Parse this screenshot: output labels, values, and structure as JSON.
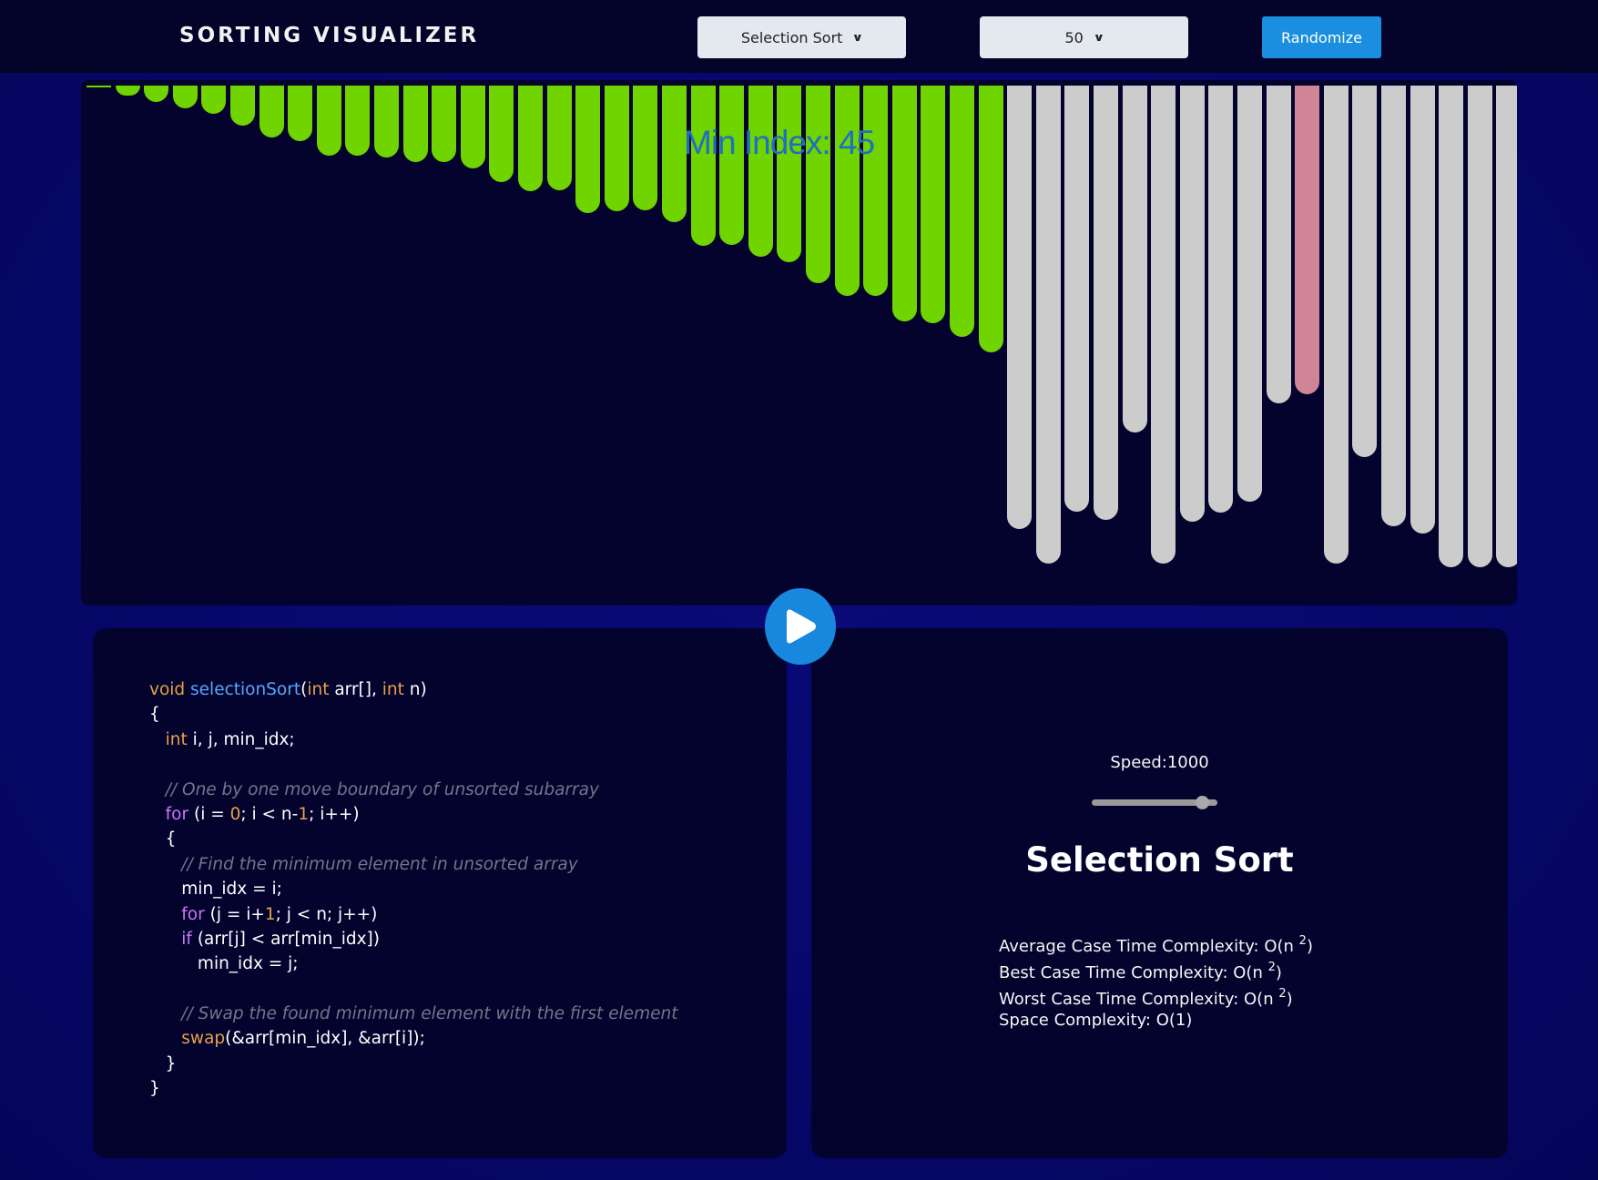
{
  "header": {
    "title": "SORTING VISUALIZER",
    "algorithm_select": {
      "selected": "Selection Sort"
    },
    "size_select": {
      "selected": "50"
    },
    "randomize_label": "Randomize"
  },
  "visualizer": {
    "min_index_label": "Min Index: 45",
    "bar_heights_relative": [
      0.004,
      0.019,
      0.032,
      0.045,
      0.056,
      0.078,
      0.101,
      0.109,
      0.137,
      0.137,
      0.141,
      0.15,
      0.15,
      0.163,
      0.19,
      0.207,
      0.205,
      0.25,
      0.246,
      0.244,
      0.268,
      0.315,
      0.312,
      0.336,
      0.347,
      0.388,
      0.412,
      0.413,
      0.463,
      0.466,
      0.493,
      0.524,
      0.87,
      0.937,
      0.835,
      0.852,
      0.68,
      0.937,
      0.855,
      0.838,
      0.816,
      0.624,
      0.606,
      0.937,
      0.728,
      0.865,
      0.878,
      0.945,
      0.945,
      0.945
    ],
    "states": [
      "sorted",
      "sorted",
      "sorted",
      "sorted",
      "sorted",
      "sorted",
      "sorted",
      "sorted",
      "sorted",
      "sorted",
      "sorted",
      "sorted",
      "sorted",
      "sorted",
      "sorted",
      "sorted",
      "sorted",
      "sorted",
      "sorted",
      "sorted",
      "sorted",
      "sorted",
      "sorted",
      "sorted",
      "sorted",
      "sorted",
      "sorted",
      "sorted",
      "sorted",
      "sorted",
      "sorted",
      "sorted",
      "unsorted",
      "unsorted",
      "unsorted",
      "unsorted",
      "unsorted",
      "unsorted",
      "unsorted",
      "unsorted",
      "unsorted",
      "unsorted",
      "current",
      "unsorted",
      "unsorted",
      "unsorted",
      "unsorted",
      "unsorted",
      "unsorted",
      "unsorted"
    ],
    "colors": {
      "sorted": "#6fd400",
      "unsorted": "#cccccc",
      "current": "#cf8595"
    }
  },
  "code": {
    "lines": [
      [
        {
          "t": "void ",
          "c": "kw"
        },
        {
          "t": "selectionSort",
          "c": "fn"
        },
        {
          "t": "("
        },
        {
          "t": "int",
          "c": "kw"
        },
        {
          "t": " arr[], "
        },
        {
          "t": "int",
          "c": "kw"
        },
        {
          "t": " n)"
        }
      ],
      [
        {
          "t": "{"
        }
      ],
      [
        {
          "t": "   "
        },
        {
          "t": "int",
          "c": "kw"
        },
        {
          "t": " i, j, min_idx;"
        }
      ],
      [
        {
          "t": ""
        }
      ],
      [
        {
          "t": "   "
        },
        {
          "t": "// One by one move boundary of unsorted subarray",
          "c": "cmt"
        }
      ],
      [
        {
          "t": "   "
        },
        {
          "t": "for",
          "c": "ctl"
        },
        {
          "t": " (i = "
        },
        {
          "t": "0",
          "c": "num"
        },
        {
          "t": "; i < n-"
        },
        {
          "t": "1",
          "c": "num"
        },
        {
          "t": "; i++)"
        }
      ],
      [
        {
          "t": "   {"
        }
      ],
      [
        {
          "t": "      "
        },
        {
          "t": "// Find the minimum element in unsorted array",
          "c": "cmt"
        }
      ],
      [
        {
          "t": "      min_idx = i;"
        }
      ],
      [
        {
          "t": "      "
        },
        {
          "t": "for",
          "c": "ctl"
        },
        {
          "t": " (j = i+"
        },
        {
          "t": "1",
          "c": "num"
        },
        {
          "t": "; j < n; j++)"
        }
      ],
      [
        {
          "t": "      "
        },
        {
          "t": "if",
          "c": "ctl"
        },
        {
          "t": " (arr[j] < arr[min_idx])"
        }
      ],
      [
        {
          "t": "         min_idx = j;"
        }
      ],
      [
        {
          "t": ""
        }
      ],
      [
        {
          "t": "      "
        },
        {
          "t": "// Swap the found minimum element with the first element",
          "c": "cmt"
        }
      ],
      [
        {
          "t": "      "
        },
        {
          "t": "swap",
          "c": "kw"
        },
        {
          "t": "(&arr[min_idx], &arr[i]);"
        }
      ],
      [
        {
          "t": "   }"
        }
      ],
      [
        {
          "t": "}"
        }
      ]
    ]
  },
  "info": {
    "speed_label": "Speed:1000",
    "speed_value_fraction": 0.88,
    "algorithm_title": "Selection Sort",
    "complexities": [
      {
        "label": "Average Case Time Complexity: O(n ",
        "sup": "2",
        "tail": ")"
      },
      {
        "label": "Best Case Time Complexity: O(n ",
        "sup": "2",
        "tail": ")"
      },
      {
        "label": "Worst Case Time Complexity: O(n ",
        "sup": "2",
        "tail": ")"
      },
      {
        "label": "Space Complexity: O(1)",
        "sup": "",
        "tail": ""
      }
    ]
  }
}
